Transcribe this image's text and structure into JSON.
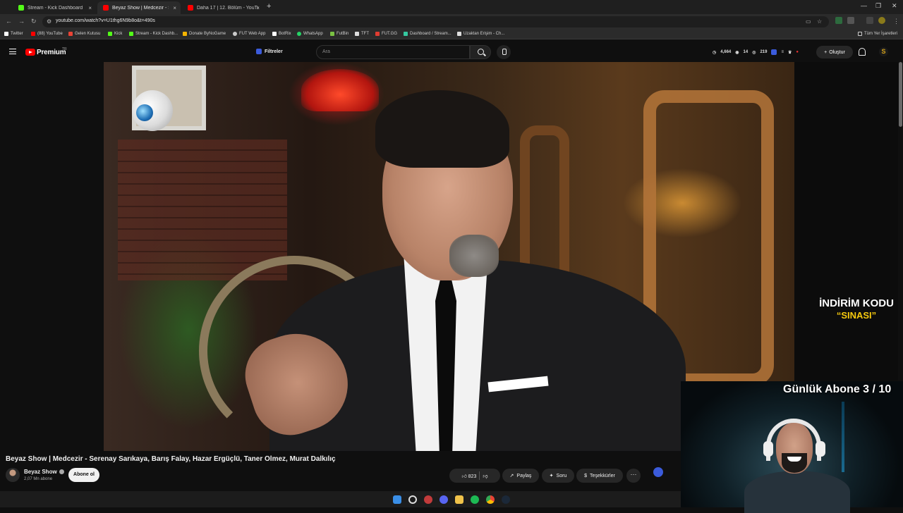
{
  "browser": {
    "tabs": [
      {
        "title": "Stream - Kick Dashboard",
        "active": false,
        "favicon_color": "#53fc18"
      },
      {
        "title": "Beyaz Show | Medcezir - Se...",
        "active": true,
        "favicon_color": "#ff0000"
      },
      {
        "title": "Daha 17 | 12. Bölüm - YouTube",
        "active": false,
        "favicon_color": "#ff0000"
      }
    ],
    "close_glyph": "×",
    "newtab_glyph": "+",
    "url": "youtube.com/watch?v=U1thg6N9b8o&t=490s",
    "bookmarks": [
      {
        "label": "Twitter",
        "color": "#ffffff"
      },
      {
        "label": "(88) YouTube",
        "color": "#ff0000"
      },
      {
        "label": "Gelen Kutusu",
        "color": "#ea4335"
      },
      {
        "label": "Kick",
        "color": "#53fc18"
      },
      {
        "label": "Stream - Kick Dashb...",
        "color": "#53fc18"
      },
      {
        "label": "Donate ByNoGame",
        "color": "#f5b400"
      },
      {
        "label": "FUT Web App",
        "color": "#cccccc"
      },
      {
        "label": "BotRix",
        "color": "#ffffff"
      },
      {
        "label": "WhatsApp",
        "color": "#25d366"
      },
      {
        "label": "FutBin",
        "color": "#7ac143"
      },
      {
        "label": "TFT",
        "color": "#dddddd"
      },
      {
        "label": "FUT.GG",
        "color": "#e03c31"
      },
      {
        "label": "Dashboard / Stream...",
        "color": "#35c8a0"
      },
      {
        "label": "Uzaktan Erişim - Ch...",
        "color": "#dddddd"
      }
    ],
    "all_bookmarks": "Tüm Yer İşaretleri"
  },
  "youtube": {
    "logo_text": "Premium",
    "country_code": "TR",
    "filters_label": "Filtreler",
    "search_placeholder": "Ara",
    "stats": {
      "viewers": "4,664",
      "watching": "14",
      "views2": "219"
    },
    "create_label": "Oluştur",
    "avatar_letter": "S"
  },
  "video": {
    "title": "Beyaz Show | Medcezir - Serenay Sarıkaya, Barış Falay, Hazar Ergüçlü, Taner Ölmez, Murat Dalkılıç",
    "channel": "Beyaz Show",
    "subscribers": "2,07 Mn abone",
    "subscribe_label": "Abone ol",
    "likes": "823",
    "share_label": "Paylaş",
    "ask_label": "Soru",
    "thanks_label": "Teşekkürler",
    "more_label": "···"
  },
  "overlay": {
    "promo_line1": "İNDİRİM KODU",
    "promo_line2": "“SINASI”",
    "sub_goal": "Günlük Abone 3 / 10"
  },
  "colors": {
    "accent_red": "#ff0000",
    "promo_yellow": "#f6c90e",
    "filter_blue": "#3b5bdb"
  }
}
